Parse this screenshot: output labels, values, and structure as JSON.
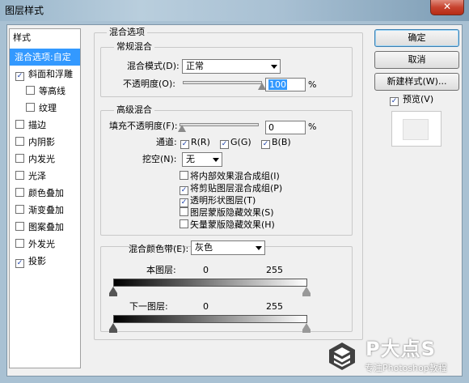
{
  "window": {
    "title": "图层样式",
    "close_label": "✕"
  },
  "sidebar": {
    "header": "样式",
    "items": [
      {
        "label": "混合选项:自定",
        "checkbox": false,
        "checked": false,
        "selected": true
      },
      {
        "label": "斜面和浮雕",
        "checkbox": true,
        "checked": true,
        "selected": false
      },
      {
        "label": "等高线",
        "checkbox": true,
        "checked": false,
        "selected": false,
        "sub": true
      },
      {
        "label": "纹理",
        "checkbox": true,
        "checked": false,
        "selected": false,
        "sub": true
      },
      {
        "label": "描边",
        "checkbox": true,
        "checked": false
      },
      {
        "label": "内阴影",
        "checkbox": true,
        "checked": false
      },
      {
        "label": "内发光",
        "checkbox": true,
        "checked": false
      },
      {
        "label": "光泽",
        "checkbox": true,
        "checked": false
      },
      {
        "label": "颜色叠加",
        "checkbox": true,
        "checked": false
      },
      {
        "label": "渐变叠加",
        "checkbox": true,
        "checked": false
      },
      {
        "label": "图案叠加",
        "checkbox": true,
        "checked": false
      },
      {
        "label": "外发光",
        "checkbox": true,
        "checked": false
      },
      {
        "label": "投影",
        "checkbox": true,
        "checked": true
      }
    ]
  },
  "blending_options": {
    "title": "混合选项",
    "general": {
      "title": "常规混合",
      "blend_mode_label": "混合模式(D):",
      "blend_mode_value": "正常",
      "opacity_label": "不透明度(O):",
      "opacity_value": "100",
      "opacity_unit": "%",
      "opacity_fraction": 1.0
    },
    "advanced": {
      "title": "高级混合",
      "fill_opacity_label": "填充不透明度(F):",
      "fill_opacity_value": "0",
      "fill_opacity_unit": "%",
      "fill_opacity_fraction": 0.0,
      "channels_label": "通道:",
      "channels": [
        {
          "label": "R(R)",
          "checked": true
        },
        {
          "label": "G(G)",
          "checked": true
        },
        {
          "label": "B(B)",
          "checked": true
        }
      ],
      "knockout_label": "挖空(N):",
      "knockout_value": "无",
      "options": [
        {
          "label": "将内部效果混合成组(I)",
          "checked": false
        },
        {
          "label": "将剪贴图层混合成组(P)",
          "checked": true
        },
        {
          "label": "透明形状图层(T)",
          "checked": true
        },
        {
          "label": "图层蒙版隐藏效果(S)",
          "checked": false
        },
        {
          "label": "矢量蒙版隐藏效果(H)",
          "checked": false
        }
      ]
    },
    "blend_if": {
      "label": "混合颜色带(E):",
      "value": "灰色",
      "this_layer_label": "本图层:",
      "this_layer_min": "0",
      "this_layer_max": "255",
      "underlying_label": "下一图层:",
      "underlying_min": "0",
      "underlying_max": "255"
    }
  },
  "buttons": {
    "ok": "确定",
    "cancel": "取消",
    "new_style": "新建样式(W)...",
    "preview_label": "预览(V)",
    "preview_checked": true
  },
  "watermark": {
    "title": "P大点S",
    "subtitle": "专注Photoshop教程"
  }
}
